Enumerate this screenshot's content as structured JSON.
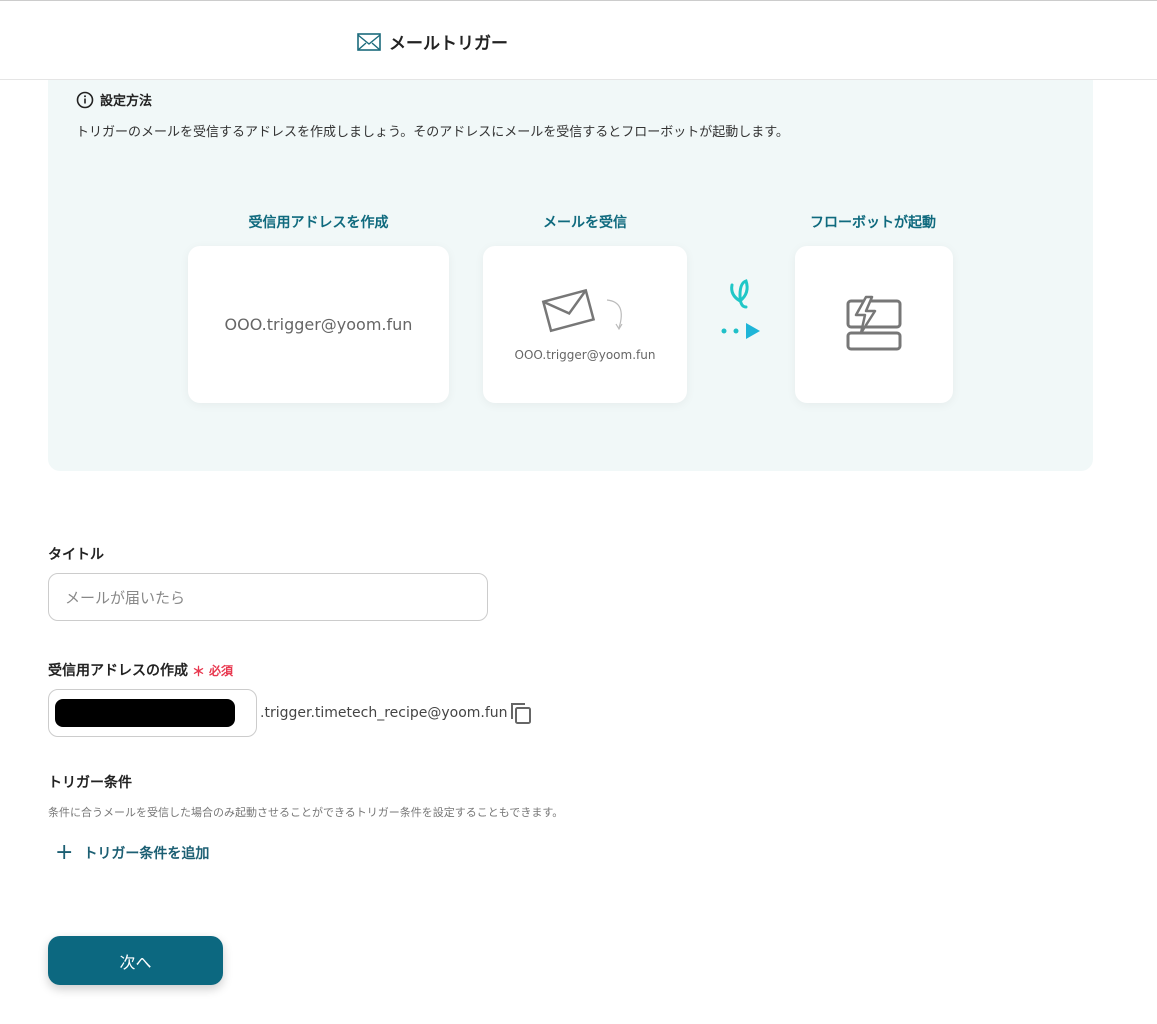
{
  "header": {
    "title": "メールトリガー",
    "icon": "mail-icon"
  },
  "guide": {
    "heading": "設定方法",
    "description": "トリガーのメールを受信するアドレスを作成しましょう。そのアドレスにメールを受信するとフローボットが起動します。",
    "steps": [
      {
        "title": "受信用アドレスを作成",
        "text": "OOO.trigger@yoom.fun"
      },
      {
        "title": "メールを受信",
        "text": "OOO.trigger@yoom.fun"
      },
      {
        "title": "フローボットが起動"
      }
    ]
  },
  "form": {
    "title_label": "タイトル",
    "title_placeholder": "メールが届いたら",
    "address_label": "受信用アドレスの作成",
    "required_mark": "＊",
    "required_text": "必須",
    "address_suffix": ".trigger.timetech_recipe@yoom.fun",
    "conditions_label": "トリガー条件",
    "conditions_desc": "条件に合うメールを受信した場合のみ起動させることができるトリガー条件を設定することもできます。",
    "add_condition": "トリガー条件を追加"
  },
  "next_button": "次へ",
  "colors": {
    "accent": "#0c6880",
    "required": "#e8384f",
    "panel": "#f1f8f8"
  }
}
